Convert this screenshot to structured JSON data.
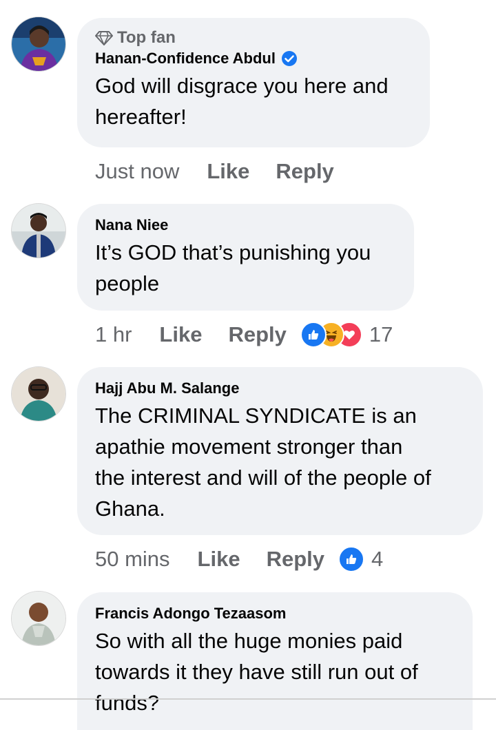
{
  "comments": [
    {
      "badge": "Top fan",
      "author": "Hanan-Confidence Abdul",
      "verified": true,
      "lines": [
        "God will disgrace you here and",
        "hereafter!"
      ],
      "time": "Just now",
      "like": "Like",
      "reply": "Reply",
      "reactions": [],
      "reaction_count": ""
    },
    {
      "author": "Nana Niee",
      "lines": [
        "It’s GOD that’s punishing you",
        "people"
      ],
      "time": "1 hr",
      "like": "Like",
      "reply": "Reply",
      "reactions": [
        "like-icon",
        "haha-icon",
        "love-icon"
      ],
      "reaction_count": "17"
    },
    {
      "author": "Hajj Abu M. Salange",
      "lines": [
        "The CRIMINAL SYNDICATE is an",
        "apathie movement stronger than",
        "the interest and will of the people of",
        "Ghana."
      ],
      "time": "50 mins",
      "like": "Like",
      "reply": "Reply",
      "reactions": [
        "like-icon"
      ],
      "reaction_count": "4"
    },
    {
      "author": "Francis Adongo Tezaasom",
      "lines": [
        "So with all the huge monies paid",
        "towards it they have still run out of",
        "funds?"
      ],
      "time": "",
      "like": "",
      "reply": "",
      "reactions": [],
      "reaction_count": ""
    }
  ],
  "colors": {
    "bubble": "#f0f2f5",
    "secondary_text": "#65676b",
    "primary_text": "#050505",
    "like_blue": "#1877f2",
    "haha_yellow": "#f7b125",
    "love_red": "#f33e58"
  }
}
